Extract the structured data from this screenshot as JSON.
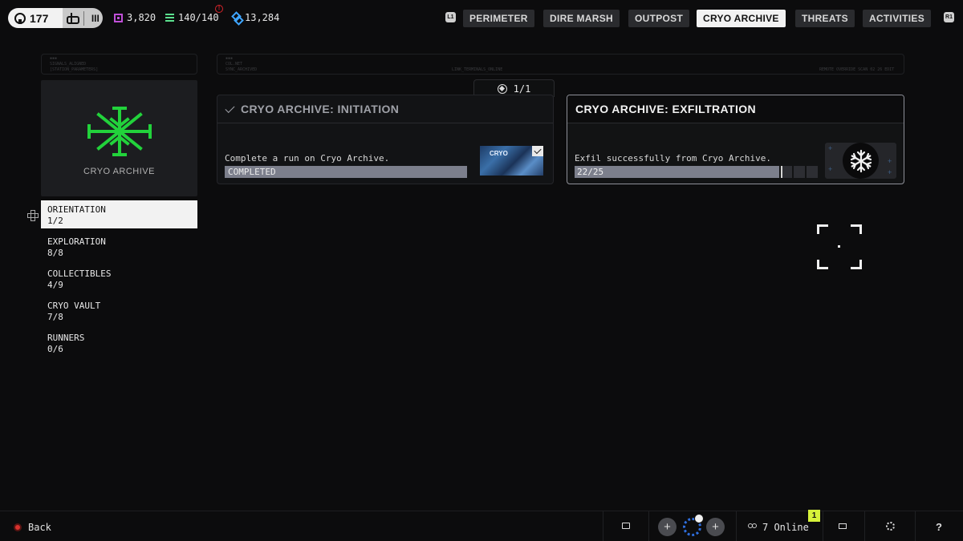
{
  "player": {
    "level": "177",
    "rank": "III"
  },
  "stats": [
    {
      "icon": "square-currency-icon",
      "value": "3,820",
      "color": "#c04fd8"
    },
    {
      "icon": "stack-icon",
      "value": "140/140",
      "color": "#5be08e"
    },
    {
      "icon": "hex-currency-icon",
      "value": "13,284",
      "color": "#3fa6ff"
    }
  ],
  "alert": "!",
  "nav": {
    "left_bumper": "L1",
    "right_bumper": "R1",
    "tabs": [
      "PERIMETER",
      "DIRE MARSH",
      "OUTPOST",
      "CRYO ARCHIVE",
      "THREATS",
      "ACTIVITIES"
    ],
    "active_tab": "CRYO ARCHIVE"
  },
  "frame_notes": {
    "left": "▪▪▪\nSIGNALS_ALIGNED\n[STATION_PARAMETERS]",
    "right_a": "▪▪▪\nCOL.NET\nSYNC_ARCHIVED",
    "right_b": "LINK_TERMINALS_ONLINE",
    "right_c": "REMOTE OVERRIDE SCAN 02 26 EDIT"
  },
  "map": {
    "label": "CRYO ARCHIVE",
    "accent": "#22d23b"
  },
  "categories": [
    {
      "name": "ORIENTATION",
      "progress": "1/2"
    },
    {
      "name": "EXPLORATION",
      "progress": "8/8"
    },
    {
      "name": "COLLECTIBLES",
      "progress": "4/9"
    },
    {
      "name": "CRYO VAULT",
      "progress": "7/8"
    },
    {
      "name": "RUNNERS",
      "progress": "0/6"
    }
  ],
  "active_category": "ORIENTATION",
  "counter": "1/1",
  "tasks": [
    {
      "title": "CRYO ARCHIVE: INITIATION",
      "description": "Complete a run on Cryo Archive.",
      "status": "COMPLETED",
      "thumb_label": "CRYO",
      "progress": 1.0
    },
    {
      "title": "CRYO ARCHIVE: EXFILTRATION",
      "description": "Exfil successfully from Cryo Archive.",
      "status": "22/25",
      "progress": 0.88
    }
  ],
  "bottom": {
    "back_label": "Back",
    "online_label": "7 Online",
    "notification_count": "1",
    "help": "?"
  }
}
